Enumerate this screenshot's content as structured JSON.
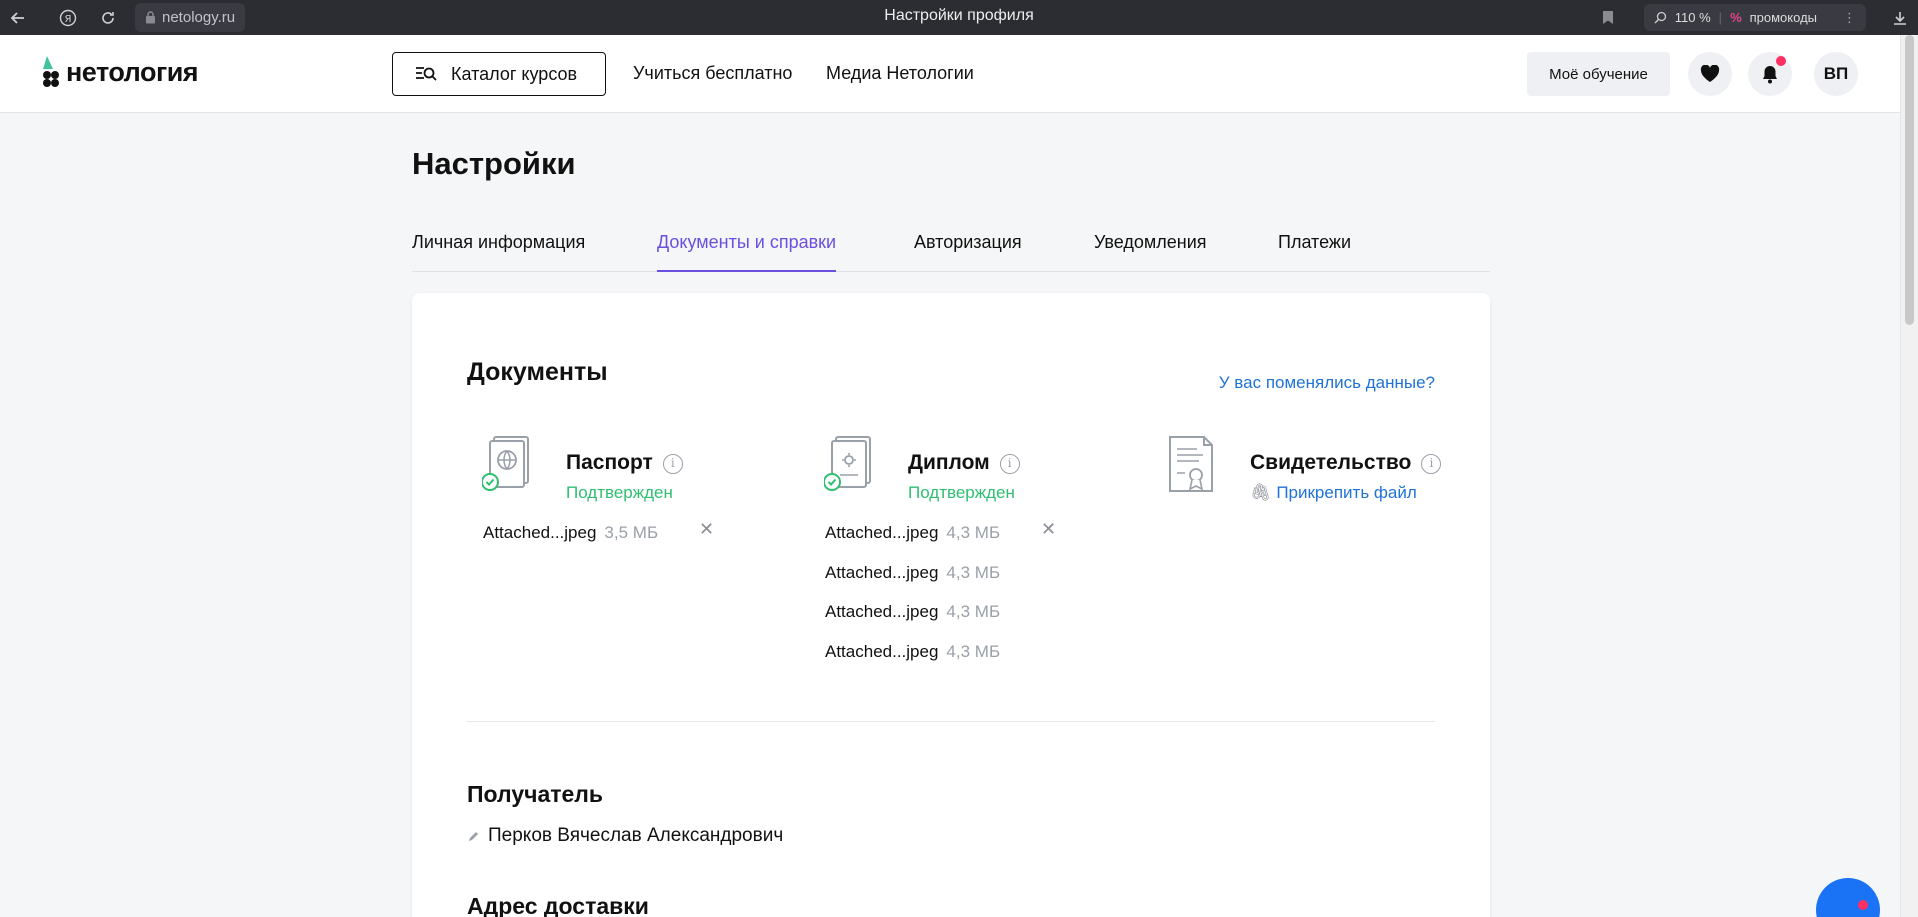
{
  "browser": {
    "url": "netology.ru",
    "page_title": "Настройки профиля",
    "zoom": "110 %",
    "promo_label": "промокоды"
  },
  "header": {
    "logo_text": "нетология",
    "catalog_label": "Каталог курсов",
    "links": [
      "Учиться бесплатно",
      "Медиа Нетологии"
    ],
    "my_learning_label": "Моё обучение",
    "avatar_initials": "ВП"
  },
  "page": {
    "title": "Настройки",
    "tabs": [
      {
        "label": "Личная информация",
        "active": false
      },
      {
        "label": "Документы и справки",
        "active": true
      },
      {
        "label": "Авторизация",
        "active": false
      },
      {
        "label": "Уведомления",
        "active": false
      },
      {
        "label": "Платежи",
        "active": false
      }
    ]
  },
  "documents": {
    "title": "Документы",
    "changed_link": "У вас поменялись данные?",
    "passport": {
      "name": "Паспорт",
      "status": "Подтвержден",
      "files": [
        {
          "name": "Attached...jpeg",
          "size": "3,5 МБ"
        }
      ]
    },
    "diploma": {
      "name": "Диплом",
      "status": "Подтвержден",
      "files": [
        {
          "name": "Attached...jpeg",
          "size": "4,3 МБ"
        },
        {
          "name": "Attached...jpeg",
          "size": "4,3 МБ"
        },
        {
          "name": "Attached...jpeg",
          "size": "4,3 МБ"
        },
        {
          "name": "Attached...jpeg",
          "size": "4,3 МБ"
        }
      ]
    },
    "certificate": {
      "name": "Свидетельство",
      "attach_label": "Прикрепить файл"
    }
  },
  "recipient": {
    "title": "Получатель",
    "name": "Перков Вячеслав Александрович"
  },
  "delivery": {
    "title": "Адрес доставки"
  },
  "colors": {
    "accent": "#6b4fe0",
    "link": "#1f72d6",
    "success": "#2fbf71",
    "notify": "#ff2e63"
  }
}
